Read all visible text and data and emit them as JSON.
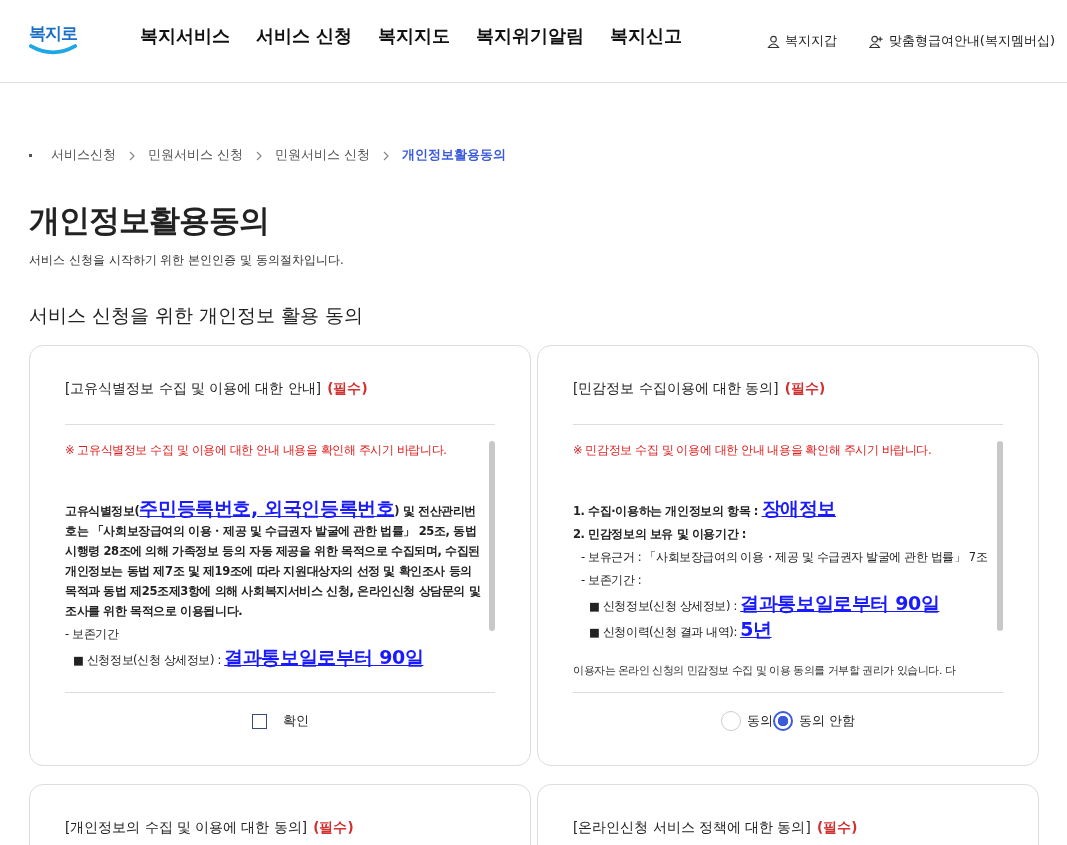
{
  "header": {
    "logo": "복지로",
    "nav": [
      "복지서비스",
      "서비스 신청",
      "복지지도",
      "복지위기알림",
      "복지신고"
    ],
    "utility_links": [
      "복지지갑",
      "맞춤형급여안내(복지멤버십)"
    ]
  },
  "breadcrumb": [
    {
      "label": "서비스신청",
      "selected": false
    },
    {
      "label": "민원서비스 신청",
      "selected": false
    },
    {
      "label": "민원서비스 신청",
      "selected": false
    },
    {
      "label": "개인정보활용동의",
      "selected": true
    }
  ],
  "page_title": "개인정보활용동의",
  "page_subtitle": "서비스 신청을 시작하기 위한 본인인증 및 동의절차입니다.",
  "section_title": "서비스 신청을 위한 개인정보 활용 동의",
  "cards": [
    {
      "title": "[고유식별정보 수집 및 이용에 대한 안내]",
      "required": "(필수)",
      "notice": "※ 고유식별정보 수집 및 이용에 대한 안내 내용을 확인해 주시기 바랍니다.",
      "lines": [
        {
          "kind": "heading",
          "parts": [
            {
              "text": "고유식별정보(",
              "highlight": false
            },
            {
              "text": "주민등록번호, 외국인등록번호",
              "highlight": true
            },
            {
              "text": ") 및 전산관리번호는 「사회보장급여의 이용・제공 및 수급권자 발굴에 관한 법률」 25조, 동법 시행령 28조에 의해 가족정보 등의 자동 제공을 위한 목적으로 수집되며, 수집된 개인정보는 동법 제7조 및 제19조에 따라 지원대상자의 선정 및 확인조사 등의 목적과 동법 제25조제3항에 의해 사회복지서비스 신청, 온라인신청 상담문의 및 조사를 위한 목적으로 이용됩니다.",
              "highlight": false
            }
          ]
        },
        {
          "kind": "item",
          "parts": [
            {
              "text": "- 보존기간",
              "highlight": false
            }
          ],
          "children": [
            {
              "kind": "item",
              "parts": [
                {
                  "text": "■ 신청정보(신청 상세정보) : ",
                  "highlight": false
                },
                {
                  "text": "결과통보일로부터 90일",
                  "highlight": true
                }
              ]
            }
          ]
        }
      ],
      "control": {
        "kind": "checkbox",
        "label": "확인",
        "checked": false
      }
    },
    {
      "title": "[민감정보 수집이용에 대한 동의]",
      "required": "(필수)",
      "notice": "※ 민감정보 수집 및 이용에 대한 안내 내용을 확인해 주시기 바랍니다.",
      "trailing": "이용자는 온라인 신청의 민감정보 수집 및 이용 동의를 거부할 권리가 있습니다. 다",
      "lines": [
        {
          "kind": "heading",
          "parts": [
            {
              "text": "1. 수집·이용하는 개인정보의 항목 : ",
              "highlight": false
            },
            {
              "text": "장애정보",
              "highlight": true
            }
          ]
        },
        {
          "kind": "heading",
          "parts": [
            {
              "text": "2. 민감정보의 보유 및 이용기간 :",
              "highlight": false
            }
          ],
          "children": [
            {
              "kind": "item",
              "parts": [
                {
                  "text": "- 보유근거 : 「사회보장급여의 이용・제공 및 수급권자 발굴에 관한 법률」 7조",
                  "highlight": false
                }
              ]
            },
            {
              "kind": "item",
              "parts": [
                {
                  "text": "- 보존기간 :",
                  "highlight": false
                }
              ],
              "children": [
                {
                  "kind": "item",
                  "parts": [
                    {
                      "text": "■ 신청정보(신청 상세정보) : ",
                      "highlight": false
                    },
                    {
                      "text": "결과통보일로부터 90일",
                      "highlight": true
                    }
                  ]
                },
                {
                  "kind": "item",
                  "parts": [
                    {
                      "text": "■ 신청이력(신청 결과 내역): ",
                      "highlight": false
                    },
                    {
                      "text": "5년",
                      "highlight": true
                    }
                  ]
                }
              ]
            }
          ]
        }
      ],
      "control": {
        "kind": "radio",
        "options": [
          {
            "label": "동의",
            "selected": false
          },
          {
            "label": "동의 안함",
            "selected": true
          }
        ]
      }
    },
    {
      "title": "[개인정보의 수집 및 이용에 대한 동의]",
      "required": "(필수)"
    },
    {
      "title": "[온라인신청 서비스 정책에 대한 동의]",
      "required": "(필수)"
    }
  ]
}
